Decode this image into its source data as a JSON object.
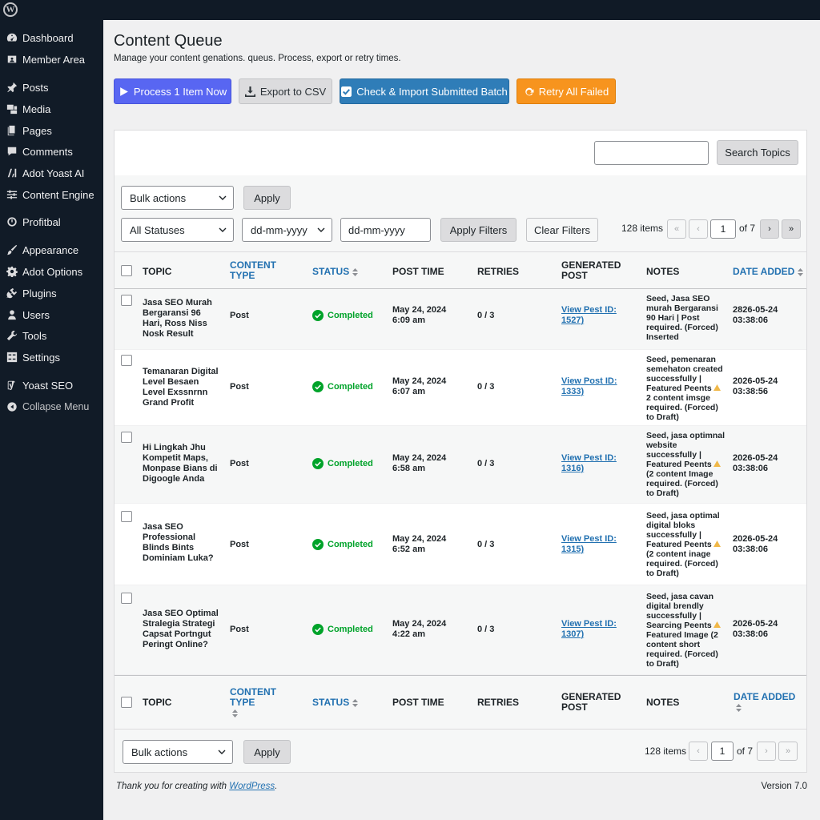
{
  "admin_bar": {
    "logo_letter": "W"
  },
  "sidebar": {
    "items": [
      {
        "label": "Dashboard",
        "icon": "dashboard-icon"
      },
      {
        "label": "Member Area",
        "icon": "member-icon"
      },
      {
        "label": "Posts",
        "icon": "pin-icon"
      },
      {
        "label": "Media",
        "icon": "media-icon"
      },
      {
        "label": "Pages",
        "icon": "pages-icon"
      },
      {
        "label": "Comments",
        "icon": "comment-icon"
      },
      {
        "label": "Adot Yoast AI",
        "icon": "ai-icon"
      },
      {
        "label": "Content Engine",
        "icon": "sliders-icon"
      },
      {
        "label": "Profitbal",
        "icon": "gauge-icon"
      },
      {
        "label": "Appearance",
        "icon": "brush-icon"
      },
      {
        "label": "Adot Options",
        "icon": "gear-icon"
      },
      {
        "label": "Plugins",
        "icon": "plug-icon"
      },
      {
        "label": "Users",
        "icon": "user-icon"
      },
      {
        "label": "Tools",
        "icon": "wrench-icon"
      },
      {
        "label": "Settings",
        "icon": "settings-icon"
      },
      {
        "label": "Yoast SEO",
        "icon": "yoast-icon"
      },
      {
        "label": "Collapse Menu",
        "icon": "collapse-icon"
      }
    ]
  },
  "page": {
    "title": "Content Queue",
    "description": "Manage your content genations. queus. Process, export or retry times."
  },
  "actions": {
    "process": "Process 1 Item Now",
    "export": "Export to CSV",
    "check_import": "Check & Import Submitted Batch",
    "retry": "Retry All Failed"
  },
  "search": {
    "button": "Search Topics",
    "value": ""
  },
  "filters": {
    "bulk_actions": "Bulk actions",
    "apply": "Apply",
    "status": "All Statuses",
    "date_from": "dd-mm-yyyy",
    "date_to": "dd-mm-yyyy",
    "apply_filters": "Apply Filters",
    "clear_filters": "Clear Filters"
  },
  "pagination": {
    "count": "128 items",
    "current_page": "1",
    "of_total": "of 7",
    "first": "«",
    "prev": "‹",
    "next": "›",
    "last": "»"
  },
  "table": {
    "columns": {
      "topic": "TOPIC",
      "content_type": "CONTENT TYPE",
      "status": "STATUS",
      "post_time": "POST TIME",
      "retries": "RETRIES",
      "generated_post": "GENERATED POST",
      "notes": "NOTES",
      "date_added": "DATE ADDED"
    },
    "rows": [
      {
        "topic": "Jasa SEO Murah Bergaransi 96 Hari, Ross Niss Nosk Result",
        "type": "Post",
        "status": "Completed",
        "post_time": "May 24, 2024 6:09 am",
        "retries": "0 / 3",
        "generated_post": "View Pest ID: 1527)",
        "notes_a": "Seed, Jasa SEO murah Bergaransi 90 Hari | Post required. (Forced) Inserted",
        "notes_b": "",
        "date_added": "2826-05-24 03:38:06"
      },
      {
        "topic": "Temanaran Digital Level Besaen Level Exssnrnn Grand Profit",
        "type": "Post",
        "status": "Completed",
        "post_time": "May 24, 2024 6:07 am",
        "retries": "0 / 3",
        "generated_post": "View Post ID: 1333)",
        "notes_a": "Seed, pemenaran semehaton created successfully | Featured Peents",
        "notes_b": "2 content imsge required. (Forced) to Draft)",
        "date_added": "2026-05-24 03:38:56"
      },
      {
        "topic": "Hi Lingkah Jhu Kompetit Maps, Monpase Bians di Digoogle Anda",
        "type": "Post",
        "status": "Completed",
        "post_time": "May 24, 2024 6:58 am",
        "retries": "0 / 3",
        "generated_post": "View Pest ID: 1316)",
        "notes_a": "Seed, jasa optimnal website successfully | Featured Peents",
        "notes_b": "(2 content Image required. (Forced) to Draft)",
        "date_added": "2026-05-24 03:38:06"
      },
      {
        "topic": "Jasa SEO Professional Blinds Bints Dominiam Luka?",
        "type": "Post",
        "status": "Completed",
        "post_time": "May 24, 2024 6:52 am",
        "retries": "0 / 3",
        "generated_post": "View Pest ID: 1315)",
        "notes_a": "Seed, jasa optimal digital bloks successfully | Featured Peents",
        "notes_b": "(2 content inage required. (Forced) to Draft)",
        "date_added": "2026-05-24 03:38:06"
      },
      {
        "topic": "Jasa SEO Optimal Stralegia Strategi Capsat Portngut Peringt Online?",
        "type": "Post",
        "status": "Completed",
        "post_time": "May 24, 2024 4:22 am",
        "retries": "0 / 3",
        "generated_post": "View Pest ID: 1307)",
        "notes_a": "Seed, jasa cavan digital brendly successfully | Searcing Peents",
        "notes_b": "Featured Image (2 content short required. (Forced) to Draft)",
        "date_added": "2026-05-24 03:38:06"
      }
    ]
  },
  "footer": {
    "thanks_prefix": "Thank you for creating with",
    "thanks_link": "WordPress",
    "thanks_suffix": ".",
    "version": "Version 7.0"
  },
  "colors": {
    "sidebar_bg": "#111b27",
    "process_btn": "#5866f2",
    "check_btn": "#2f7db8",
    "retry_btn": "#f7941e",
    "completed_green": "#00a32a",
    "link_blue": "#2271b1",
    "warning": "#f0b849"
  }
}
